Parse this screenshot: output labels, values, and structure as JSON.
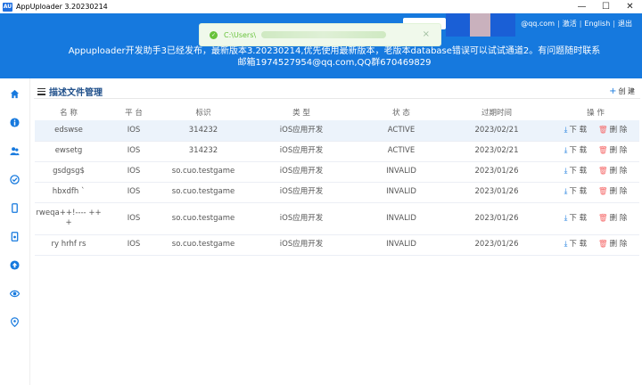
{
  "app": {
    "icon_text": "AU",
    "title": "AppUploader 3.20230214",
    "win_min": "—",
    "win_max": "☐",
    "win_close": "✕"
  },
  "header": {
    "email_suffix": "@qq.com",
    "activate": "激活",
    "language": "English",
    "logout": "退出",
    "notice_line1": "Appuploader开发助手3已经发布，最新版本3.20230214,优先使用最新版本，老版本database错误可以试试通道2。有问题随时联系",
    "notice_line2": "邮箱1974527954@qq.com,QQ群670469829"
  },
  "toast": {
    "message": "C:\\Users\\",
    "close": "×"
  },
  "sidebar": {
    "items": [
      "home-icon",
      "info-icon",
      "users-icon",
      "check-circle-icon",
      "device-icon",
      "file-icon",
      "upload-icon",
      "eye-icon",
      "location-icon"
    ]
  },
  "section": {
    "title": "描述文件管理",
    "create_label": "创 建"
  },
  "table": {
    "headers": [
      "名 称",
      "平 台",
      "标识",
      "类 型",
      "状 态",
      "过期时间",
      "操 作"
    ],
    "rows": [
      {
        "name": "edswse",
        "platform": "IOS",
        "identifier": "314232",
        "type": "iOS应用开发",
        "status": "ACTIVE",
        "expiry": "2023/02/21"
      },
      {
        "name": "ewsetg",
        "platform": "IOS",
        "identifier": "314232",
        "type": "iOS应用开发",
        "status": "ACTIVE",
        "expiry": "2023/02/21"
      },
      {
        "name": "gsdgsg$",
        "platform": "IOS",
        "identifier": "so.cuo.testgame",
        "type": "iOS应用开发",
        "status": "INVALID",
        "expiry": "2023/01/26"
      },
      {
        "name": "hbxdfh  `",
        "platform": "IOS",
        "identifier": "so.cuo.testgame",
        "type": "iOS应用开发",
        "status": "INVALID",
        "expiry": "2023/01/26"
      },
      {
        "name": "rweqa++!---- ++ +",
        "platform": "IOS",
        "identifier": "so.cuo.testgame",
        "type": "iOS应用开发",
        "status": "INVALID",
        "expiry": "2023/01/26"
      },
      {
        "name": "ry hrhf rs",
        "platform": "IOS",
        "identifier": "so.cuo.testgame",
        "type": "iOS应用开发",
        "status": "INVALID",
        "expiry": "2023/01/26"
      }
    ],
    "download_label": "下 载",
    "delete_label": "删 除"
  },
  "colors": {
    "banner": "#1679de",
    "highlight_row": "#ecf3fb",
    "success": "#67c23a",
    "danger": "#f56c6c"
  }
}
